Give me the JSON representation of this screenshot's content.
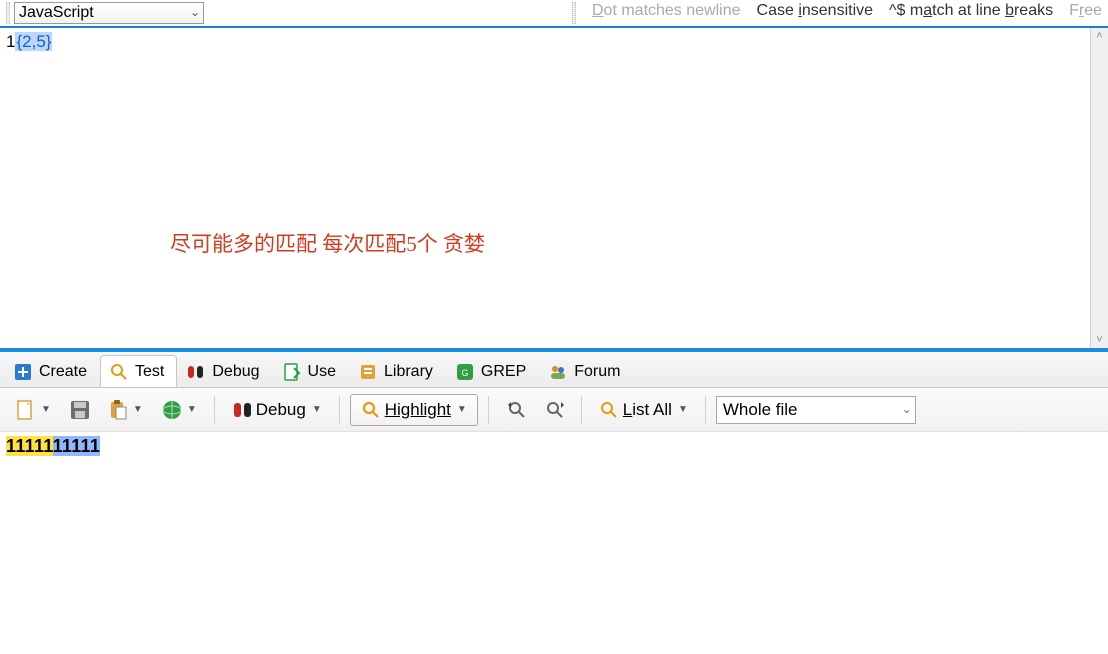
{
  "top": {
    "flavor": "JavaScript",
    "options": {
      "dot": "Dot matches newline",
      "case": "Case insensitive",
      "anchors": "^$ match at line breaks",
      "free": "Free"
    }
  },
  "regex": {
    "literal": "1",
    "quant": "{2,5}"
  },
  "annotation": "尽可能多的匹配 每次匹配5个 贪婪",
  "tabs": {
    "create": "Create",
    "test": "Test",
    "debug": "Debug",
    "use": "Use",
    "library": "Library",
    "grep": "GREP",
    "forum": "Forum",
    "active": "test"
  },
  "toolbar": {
    "debug": "Debug",
    "highlight": "Highlight",
    "listall": "List All",
    "scope": "Whole file"
  },
  "test": {
    "seg1": "11111",
    "seg2": "11111"
  }
}
